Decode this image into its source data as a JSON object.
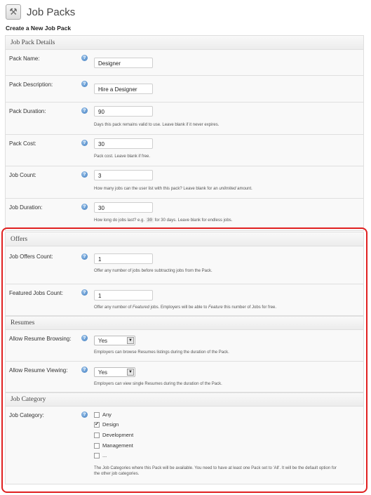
{
  "header": {
    "title": "Job Packs",
    "icon": "tools-icon"
  },
  "subtitle": "Create a New Job Pack",
  "details": {
    "heading": "Job Pack Details",
    "pack_name": {
      "label": "Pack Name:",
      "value": "Designer"
    },
    "pack_description": {
      "label": "Pack Description:",
      "value": "Hire a Designer"
    },
    "pack_duration": {
      "label": "Pack Duration:",
      "value": "90",
      "desc": "Days this pack remains valid to use. Leave blank if it never expires."
    },
    "pack_cost": {
      "label": "Pack Cost:",
      "value": "30",
      "desc": "Pack cost. Leave blank if free."
    },
    "job_count": {
      "label": "Job Count:",
      "value": "3",
      "desc_a": "How many jobs can the user list with this pack? Leave blank for an ",
      "desc_em": "unlimited",
      "desc_b": " amount."
    },
    "job_duration": {
      "label": "Job Duration:",
      "value": "30",
      "desc_a": "How long do jobs last? e.g. ",
      "desc_code": "30",
      "desc_b": " for 30 days. Leave blank for endless jobs."
    }
  },
  "offers": {
    "heading": "Offers",
    "job_offers_count": {
      "label": "Job Offers Count:",
      "value": "1",
      "desc": "Offer any number of jobs before subtracting jobs from the Pack."
    },
    "featured_jobs_count": {
      "label": "Featured Jobs Count:",
      "value": "1",
      "desc_a": "Offer any number of ",
      "desc_em1": "Featured",
      "desc_b": " jobs. Employers will be able to ",
      "desc_em2": "Feature",
      "desc_c": " this number of Jobs for free."
    }
  },
  "resumes": {
    "heading": "Resumes",
    "allow_browsing": {
      "label": "Allow Resume Browsing:",
      "value": "Yes",
      "desc": "Employers can browse Resumes listings during the duration of the Pack."
    },
    "allow_viewing": {
      "label": "Allow Resume Viewing:",
      "value": "Yes",
      "desc": "Employers can view single Resumes during the duration of the Pack."
    }
  },
  "category": {
    "heading": "Job Category",
    "label": "Job Category:",
    "options": [
      {
        "label": "Any",
        "checked": false
      },
      {
        "label": "Design",
        "checked": true
      },
      {
        "label": "Development",
        "checked": false
      },
      {
        "label": "Management",
        "checked": false
      },
      {
        "label": "...",
        "checked": false
      }
    ],
    "check_mark": "✔",
    "desc_line1": "The Job Categories where this Pack will be available. You need to have at least one Pack set to 'All'. It will be the default option for",
    "desc_line2": "the other job categories."
  },
  "help_glyph": "?",
  "select_arrow": "▼",
  "colors": {
    "highlight": "#e02020",
    "help": "#3f7cbf"
  }
}
